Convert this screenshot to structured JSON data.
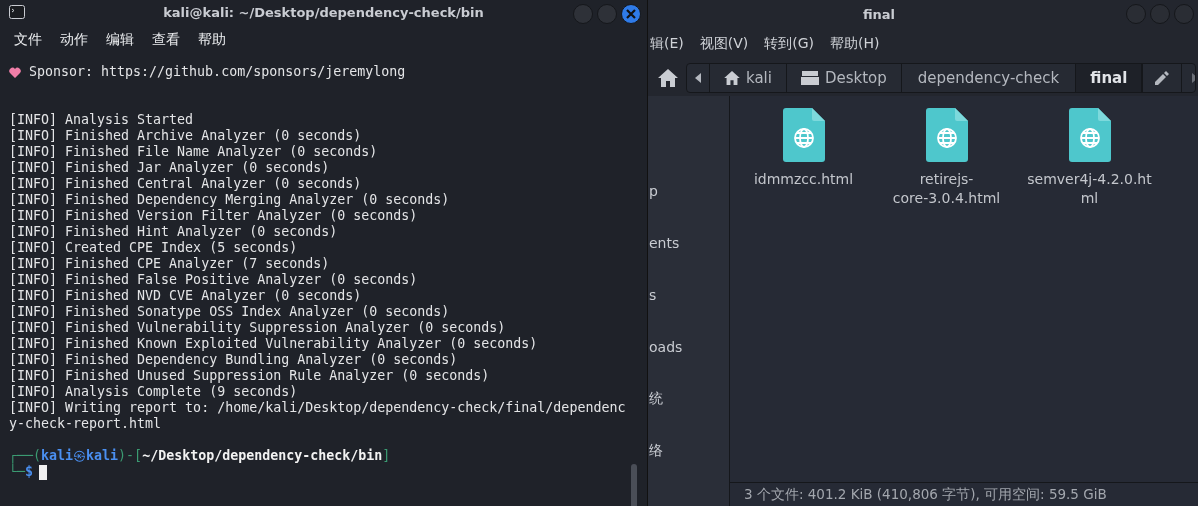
{
  "file_manager": {
    "title": "final",
    "menu": [
      "辑(E)",
      "视图(V)",
      "转到(G)",
      "帮助(H)"
    ],
    "breadcrumbs": [
      {
        "label": "kali",
        "selected": false
      },
      {
        "label": "Desktop",
        "selected": false
      },
      {
        "label": "dependency-check",
        "selected": false
      },
      {
        "label": "final",
        "selected": true
      }
    ],
    "sidebar": [
      {
        "kind": "hidden"
      },
      {
        "kind": "hidden"
      },
      {
        "kind": "hidden"
      },
      {
        "kind": "item",
        "text": "p"
      },
      {
        "kind": "hidden"
      },
      {
        "kind": "item",
        "text": "ents"
      },
      {
        "kind": "hidden"
      },
      {
        "kind": "item",
        "text": "s"
      },
      {
        "kind": "hidden"
      },
      {
        "kind": "item",
        "text": "oads"
      },
      {
        "kind": "hidden"
      },
      {
        "kind": "item",
        "text": "统"
      },
      {
        "kind": "hidden"
      },
      {
        "kind": "item",
        "text": "络"
      }
    ],
    "files": [
      {
        "lines": [
          "idmmzcc.html"
        ]
      },
      {
        "lines": [
          "retirejs-",
          "core-3.0.4.html"
        ]
      },
      {
        "lines": [
          "semver4j-4.2.0.ht",
          "ml"
        ]
      }
    ],
    "status_bar": "3 个文件: 401.2 KiB (410,806 字节), 可用空间: 59.5 GiB"
  },
  "terminal": {
    "title": "kali@kali: ~/Desktop/dependency-check/bin",
    "menu": [
      "文件",
      "动作",
      "编辑",
      "查看",
      "帮助"
    ],
    "sponsor": "Sponsor: https://github.com/sponsors/jeremylong",
    "log": [
      "[INFO] Analysis Started",
      "[INFO] Finished Archive Analyzer (0 seconds)",
      "[INFO] Finished File Name Analyzer (0 seconds)",
      "[INFO] Finished Jar Analyzer (0 seconds)",
      "[INFO] Finished Central Analyzer (0 seconds)",
      "[INFO] Finished Dependency Merging Analyzer (0 seconds)",
      "[INFO] Finished Version Filter Analyzer (0 seconds)",
      "[INFO] Finished Hint Analyzer (0 seconds)",
      "[INFO] Created CPE Index (5 seconds)",
      "[INFO] Finished CPE Analyzer (7 seconds)",
      "[INFO] Finished False Positive Analyzer (0 seconds)",
      "[INFO] Finished NVD CVE Analyzer (0 seconds)",
      "[INFO] Finished Sonatype OSS Index Analyzer (0 seconds)",
      "[INFO] Finished Vulnerability Suppression Analyzer (0 seconds)",
      "[INFO] Finished Known Exploited Vulnerability Analyzer (0 seconds)",
      "[INFO] Finished Dependency Bundling Analyzer (0 seconds)",
      "[INFO] Finished Unused Suppression Rule Analyzer (0 seconds)",
      "[INFO] Analysis Complete (9 seconds)",
      "[INFO] Writing report to: /home/kali/Desktop/dependency-check/final/dependenc",
      "y-check-report.html"
    ],
    "prompt": {
      "open": "┌──(",
      "user": "kali",
      "at": "㉿",
      "host": "kali",
      "mid": ")-[",
      "path": "~/Desktop/dependency-check/bin",
      "close": "]",
      "corner": "└─",
      "symbol": "$"
    }
  }
}
